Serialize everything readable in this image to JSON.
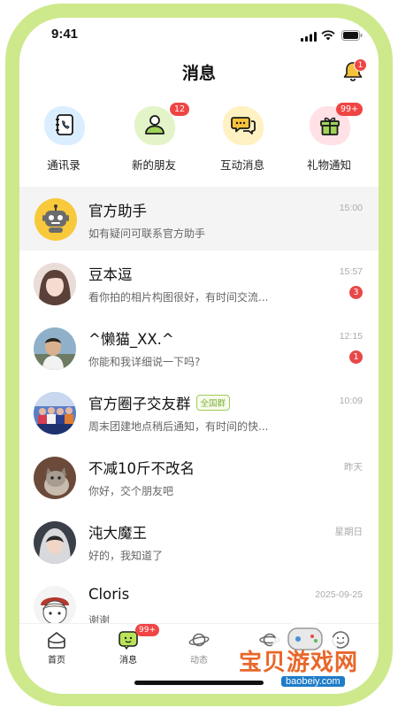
{
  "status_bar": {
    "time": "9:41"
  },
  "header": {
    "title": "消息",
    "bell_badge": "1"
  },
  "quick_actions": [
    {
      "label": "通讯录",
      "icon": "contacts-icon",
      "badge": "",
      "color": "#dbeeff"
    },
    {
      "label": "新的朋友",
      "icon": "new-friend-icon",
      "badge": "12",
      "color": "#e3f5c8"
    },
    {
      "label": "互动消息",
      "icon": "chat-bubbles-icon",
      "badge": "",
      "color": "#fff1c2"
    },
    {
      "label": "礼物通知",
      "icon": "gift-icon",
      "badge": "99+",
      "color": "#ffe1e6"
    }
  ],
  "conversations": [
    {
      "name": "官方助手",
      "preview": "如有疑问可联系官方助手",
      "time": "15:00",
      "unread": "",
      "tag": "",
      "pinned": true
    },
    {
      "name": "豆本逗",
      "preview": "看你拍的相片构图很好，有时间交流...",
      "time": "15:57",
      "unread": "3",
      "tag": ""
    },
    {
      "name": "^懒猫_XX.^",
      "preview": "你能和我详细说一下吗?",
      "time": "12:15",
      "unread": "1",
      "tag": ""
    },
    {
      "name": "官方圈子交友群",
      "preview": "周末团建地点稍后通知，有时间的快...",
      "time": "10:09",
      "unread": "",
      "tag": "全国群"
    },
    {
      "name": "不减10斤不改名",
      "preview": "你好，交个朋友吧",
      "time": "昨天",
      "unread": "",
      "tag": ""
    },
    {
      "name": "沌大魔王",
      "preview": "好的，我知道了",
      "time": "星期日",
      "unread": "",
      "tag": ""
    },
    {
      "name": "Cloris",
      "preview": "谢谢",
      "time": "2025-09-25",
      "unread": "",
      "tag": ""
    }
  ],
  "tabbar": {
    "tabs": [
      {
        "label": "首页",
        "icon": "home-icon"
      },
      {
        "label": "消息",
        "icon": "message-icon",
        "badge": "99+"
      },
      {
        "label": "动态",
        "icon": "planet-icon"
      },
      {
        "label": "",
        "icon": "planet-icon"
      },
      {
        "label": "",
        "icon": "smiley-icon"
      }
    ]
  },
  "watermark": {
    "text": "宝贝游戏网",
    "url": "baobeiy.com"
  },
  "colors": {
    "accent_green": "#cde98c",
    "badge_red": "#f04545",
    "tag_green": "#7fb13a"
  }
}
